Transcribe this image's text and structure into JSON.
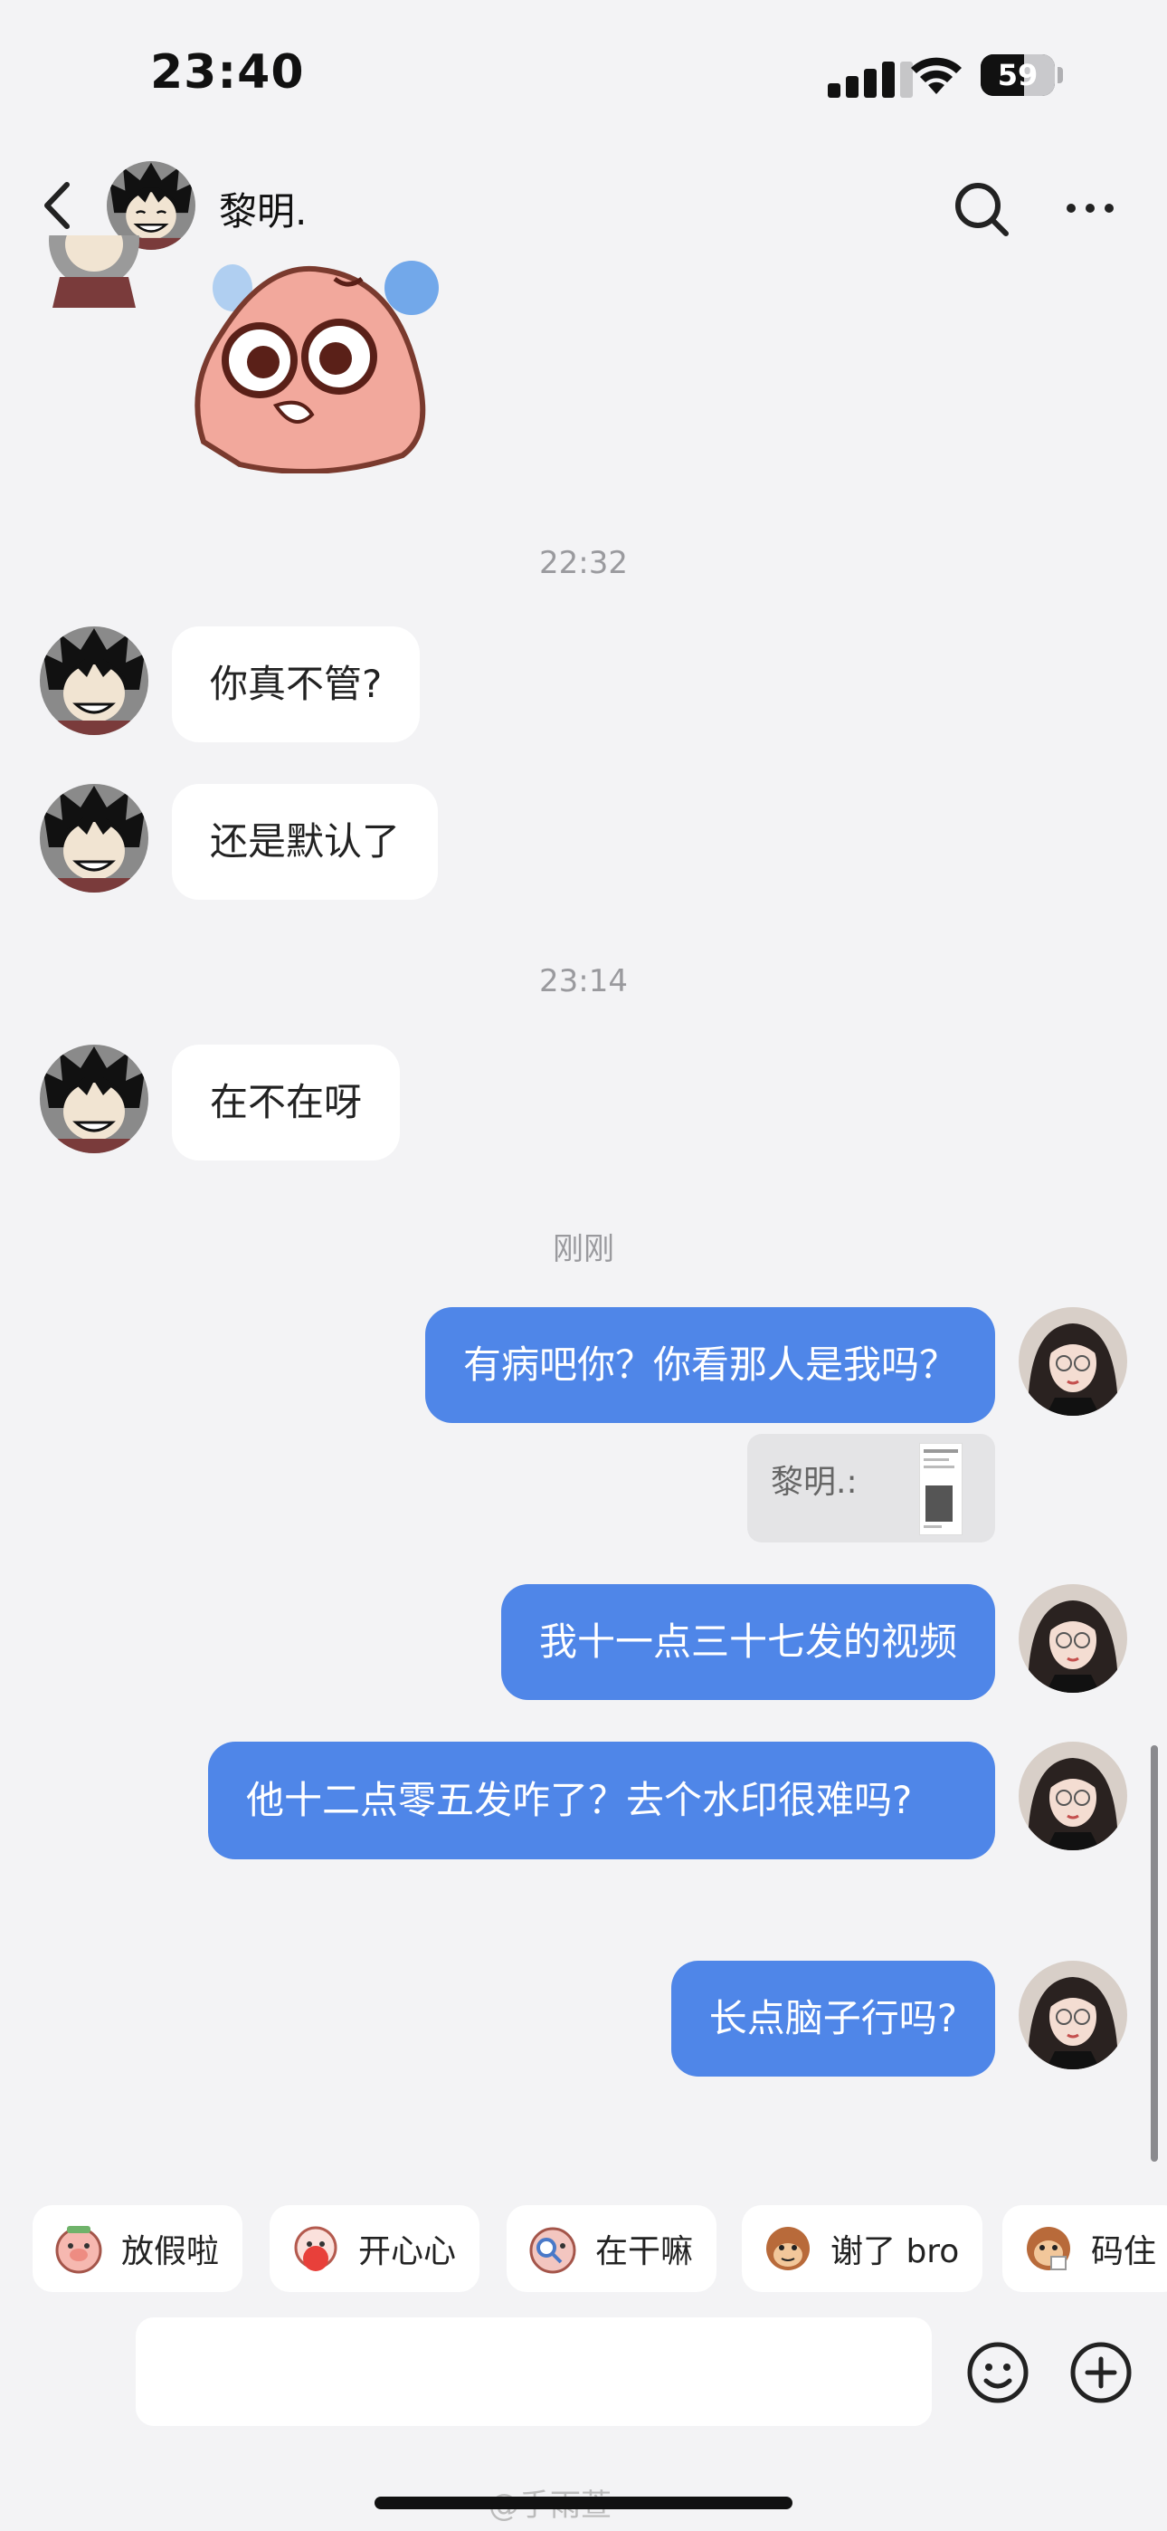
{
  "status_bar": {
    "time": "23:40",
    "battery": "59",
    "battery_level": 0.59
  },
  "header": {
    "contact_name": "黎明."
  },
  "messages": [
    {
      "type": "timestamp",
      "text": "22:32"
    },
    {
      "type": "incoming",
      "text": "你真不管?"
    },
    {
      "type": "incoming",
      "text": "还是默认了"
    },
    {
      "type": "timestamp",
      "text": "23:14"
    },
    {
      "type": "incoming",
      "text": "在不在呀"
    },
    {
      "type": "timestamp",
      "text": "刚刚"
    },
    {
      "type": "outgoing",
      "text": "有病吧你？你看那人是我吗？",
      "quote": "黎明.:"
    },
    {
      "type": "outgoing",
      "text": "我十一点三十七发的视频"
    },
    {
      "type": "outgoing",
      "text": "他十二点零五发咋了？去个水印很难吗?"
    },
    {
      "type": "outgoing",
      "text": "长点脑子行吗?"
    }
  ],
  "quick_replies": [
    {
      "label": "放假啦",
      "icon": "pig-sticker-icon"
    },
    {
      "label": "开心心",
      "icon": "happy-sticker-icon"
    },
    {
      "label": "在干嘛",
      "icon": "peek-sticker-icon"
    },
    {
      "label": "谢了 bro",
      "icon": "monkey-sticker-icon"
    },
    {
      "label": "码住",
      "icon": "monkey-note-sticker-icon"
    }
  ],
  "watermark": "@手雨萱",
  "colors": {
    "outgoing_bubble": "#4f86e8",
    "incoming_bubble": "#ffffff",
    "background": "#f3f3f5"
  }
}
